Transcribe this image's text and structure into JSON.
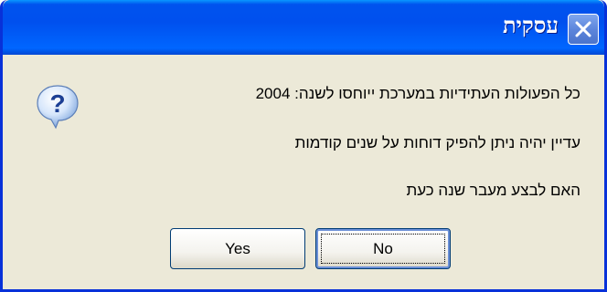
{
  "window": {
    "title": "עסקית"
  },
  "dialog": {
    "icon": "question-icon",
    "lines": [
      "כל הפעולות העתידיות במערכת ייוחסו לשנה: 2004",
      "עדיין יהיה ניתן להפיק דוחות על שנים קודמות",
      "האם לבצע מעבר שנה כעת"
    ]
  },
  "buttons": {
    "yes_label": "Yes",
    "no_label": "No"
  },
  "colors": {
    "titlebar": "#0053ee",
    "frame": "#0831d9",
    "body": "#ece9d8"
  }
}
